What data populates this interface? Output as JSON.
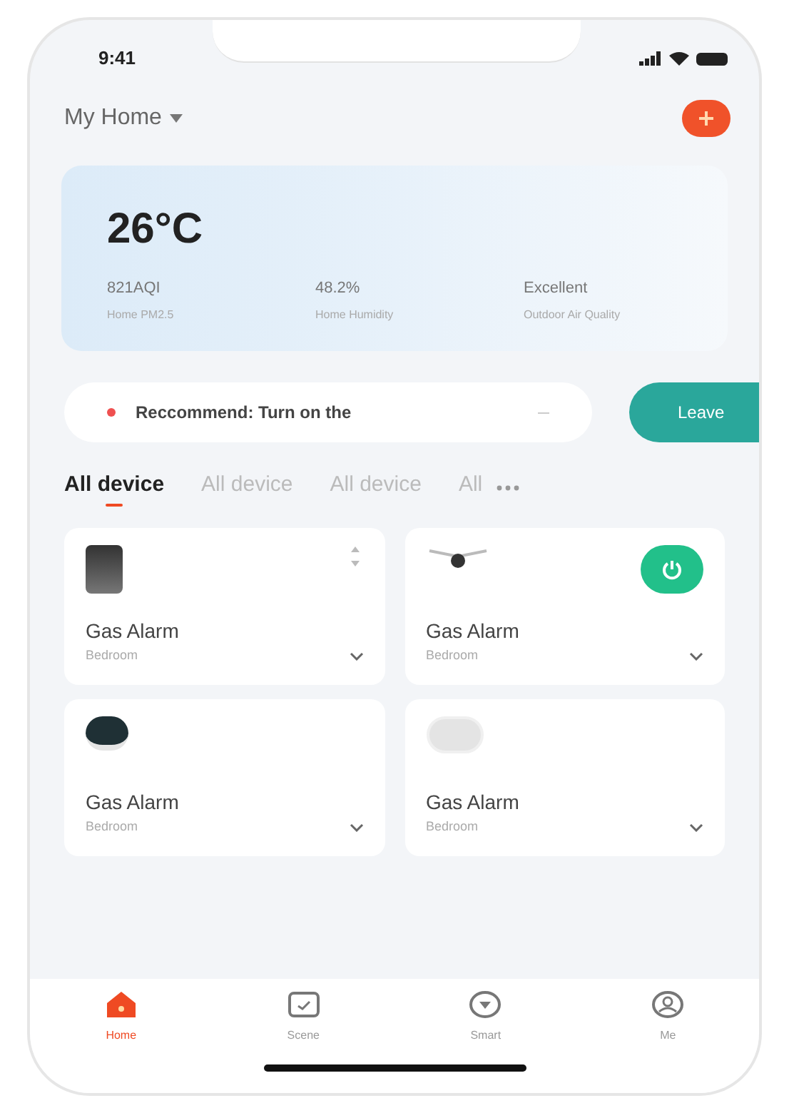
{
  "status_bar": {
    "time": "9:41"
  },
  "header": {
    "home_name": "My Home"
  },
  "weather": {
    "temperature": "26°C",
    "stats": [
      {
        "value": "821AQI",
        "label": "Home PM2.5"
      },
      {
        "value": "48.2%",
        "label": "Home Humidity"
      },
      {
        "value": "Excellent",
        "label": "Outdoor Air Quality"
      }
    ]
  },
  "recommendation": {
    "text": "Reccommend: Turn on the",
    "action": "Leave"
  },
  "tabs": [
    {
      "label": "All device",
      "selected": true
    },
    {
      "label": "All device",
      "selected": false
    },
    {
      "label": "All device",
      "selected": false
    },
    {
      "label": "All",
      "selected": false
    }
  ],
  "devices": [
    {
      "name": "Gas Alarm",
      "room": "Bedroom",
      "kind": "panel",
      "control": {
        "kind": "swap"
      }
    },
    {
      "name": "Gas Alarm",
      "room": "Bedroom",
      "kind": "camera",
      "control": {
        "kind": "power"
      }
    },
    {
      "name": "Gas Alarm",
      "room": "Bedroom",
      "kind": "hub"
    },
    {
      "name": "Gas Alarm",
      "room": "Bedroom",
      "kind": "sensor"
    }
  ],
  "bottom_nav": [
    {
      "label": "Home",
      "kind": "home",
      "selected": true
    },
    {
      "label": "Scene",
      "kind": "scene",
      "selected": false
    },
    {
      "label": "Smart",
      "kind": "smart",
      "selected": false
    },
    {
      "label": "Me",
      "kind": "me",
      "selected": false
    }
  ]
}
